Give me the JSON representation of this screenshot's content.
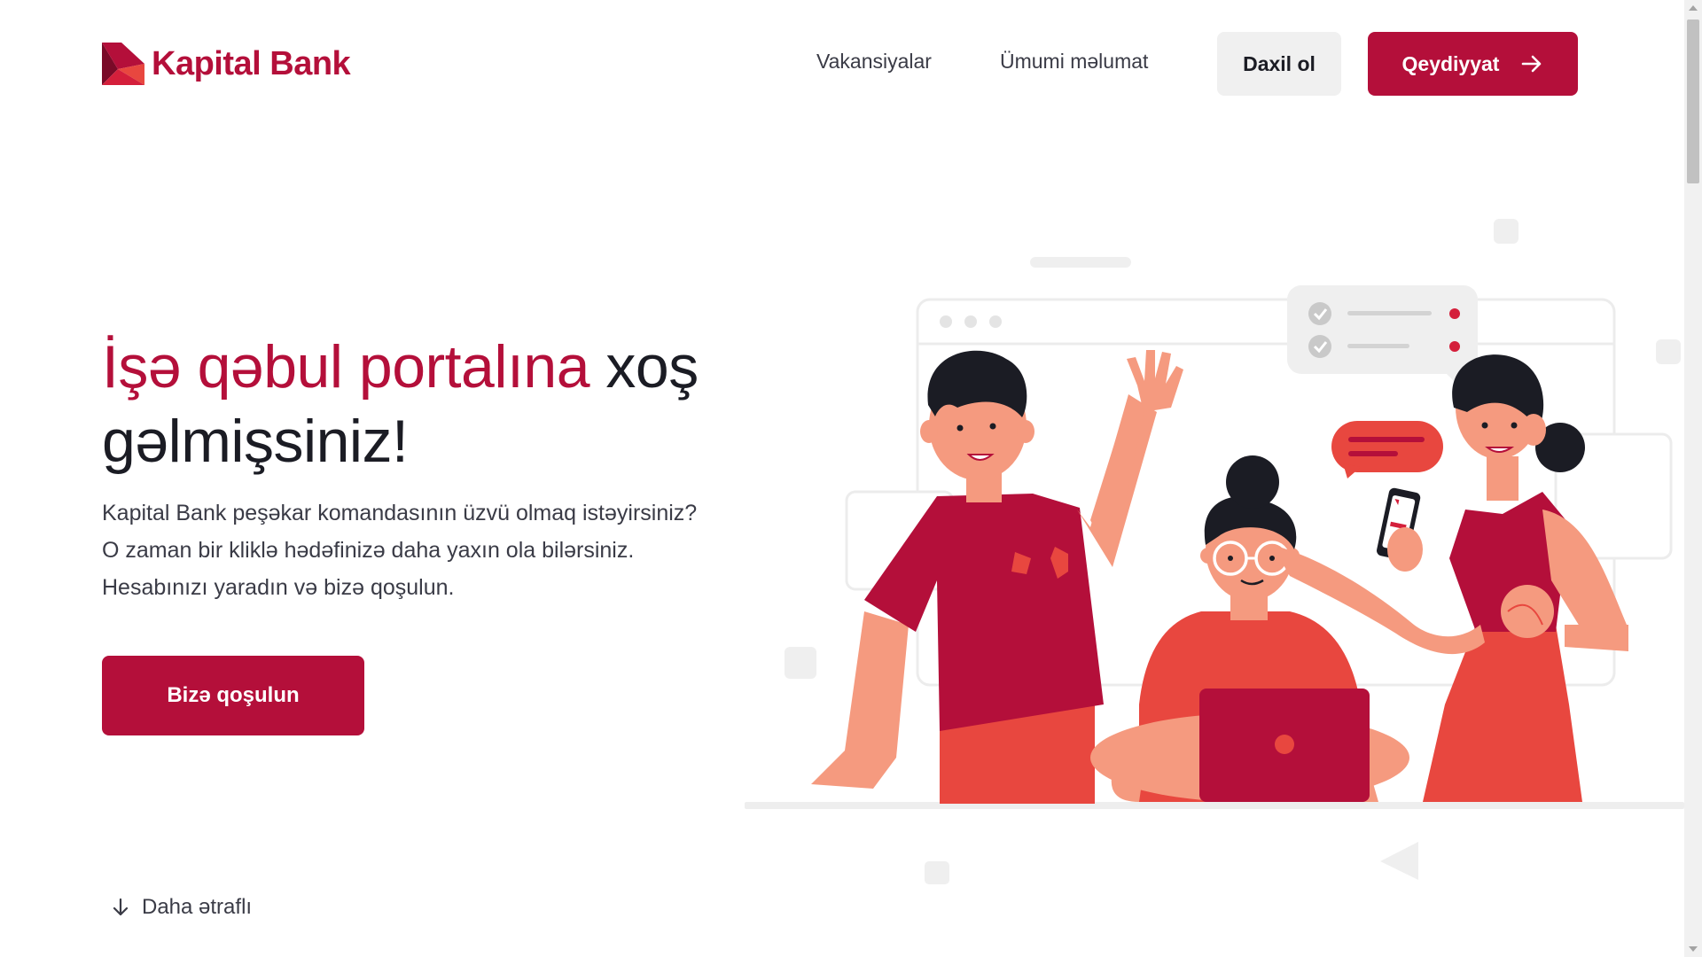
{
  "brand": {
    "name": "Kapital Bank",
    "color": "#b40f3a"
  },
  "nav": {
    "vakansiyalar": "Vakansiyalar",
    "umumi": "Ümumi məlumat",
    "login": "Daxil ol",
    "register": "Qeydiyyat"
  },
  "hero": {
    "title_accent": "İşə qəbul portalına",
    "title_rest": " xoş gəlmişsiniz!",
    "desc_line1": "Kapital Bank peşəkar komandasının üzvü olmaq istəyirsiniz?",
    "desc_line2": "O zaman bir kliklə hədəfinizə daha yaxın ola bilərsiniz.",
    "desc_line3": "Hesabınızı yaradın və bizə qoşulun.",
    "cta": "Bizə qoşulun"
  },
  "more": {
    "label": "Daha ətraflı"
  },
  "icons": {
    "logo": "kapital-bank-logo-icon",
    "register_arrow": "arrow-right-icon",
    "more_arrow": "arrow-down-icon"
  },
  "colors": {
    "primary": "#b40f3a",
    "secondary_red": "#e8473f",
    "skin": "#f59a7f",
    "dark": "#1b1c24",
    "light_gray": "#f0f0f0"
  }
}
